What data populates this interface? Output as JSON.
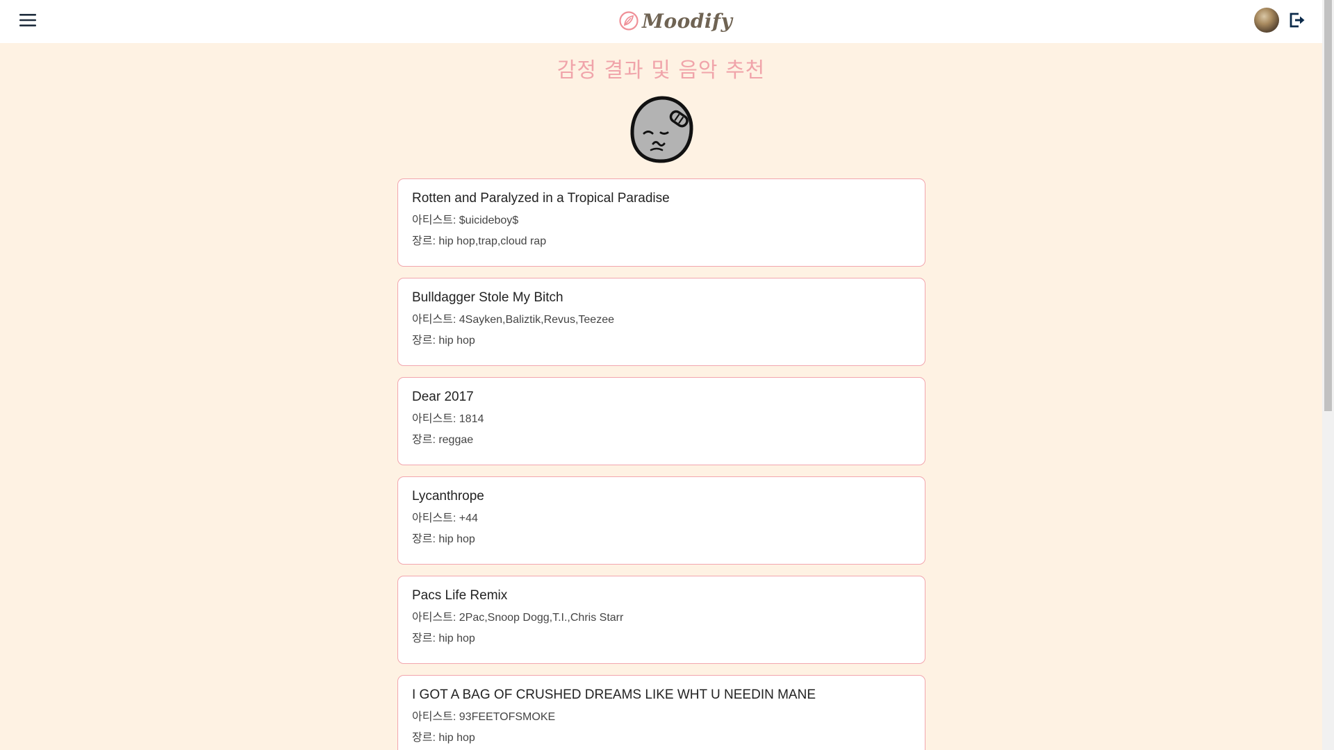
{
  "header": {
    "logo_text": "Moodify",
    "menu_icon": "hamburger-menu-icon",
    "avatar": "user-avatar",
    "logout_icon": "logout-icon"
  },
  "main": {
    "title": "감정 결과 및 음악 추천",
    "emotion_icon": "sick-face-icon"
  },
  "songs": [
    {
      "title": "Rotten and Paralyzed in a Tropical Paradise",
      "artist": "아티스트: $uicideboy$",
      "genre": "장르: hip hop,trap,cloud rap"
    },
    {
      "title": "Bulldagger Stole My Bitch",
      "artist": "아티스트: 4Sayken,Baliztik,Revus,Teezee",
      "genre": "장르: hip hop"
    },
    {
      "title": "Dear 2017",
      "artist": "아티스트: 1814",
      "genre": "장르: reggae"
    },
    {
      "title": "Lycanthrope",
      "artist": "아티스트: +44",
      "genre": "장르: hip hop"
    },
    {
      "title": "Pacs Life Remix",
      "artist": "아티스트: 2Pac,Snoop Dogg,T.I.,Chris Starr",
      "genre": "장르: hip hop"
    },
    {
      "title": "I GOT A BAG OF CRUSHED DREAMS LIKE WHT U NEEDIN MANE",
      "artist": "아티스트: 93FEETOFSMOKE",
      "genre": "장르: hip hop"
    }
  ],
  "colors": {
    "background": "#fef2e3",
    "accent_pink": "#f0a4aa",
    "card_border": "#f2a5ad",
    "logo_brown": "#6f6353"
  }
}
